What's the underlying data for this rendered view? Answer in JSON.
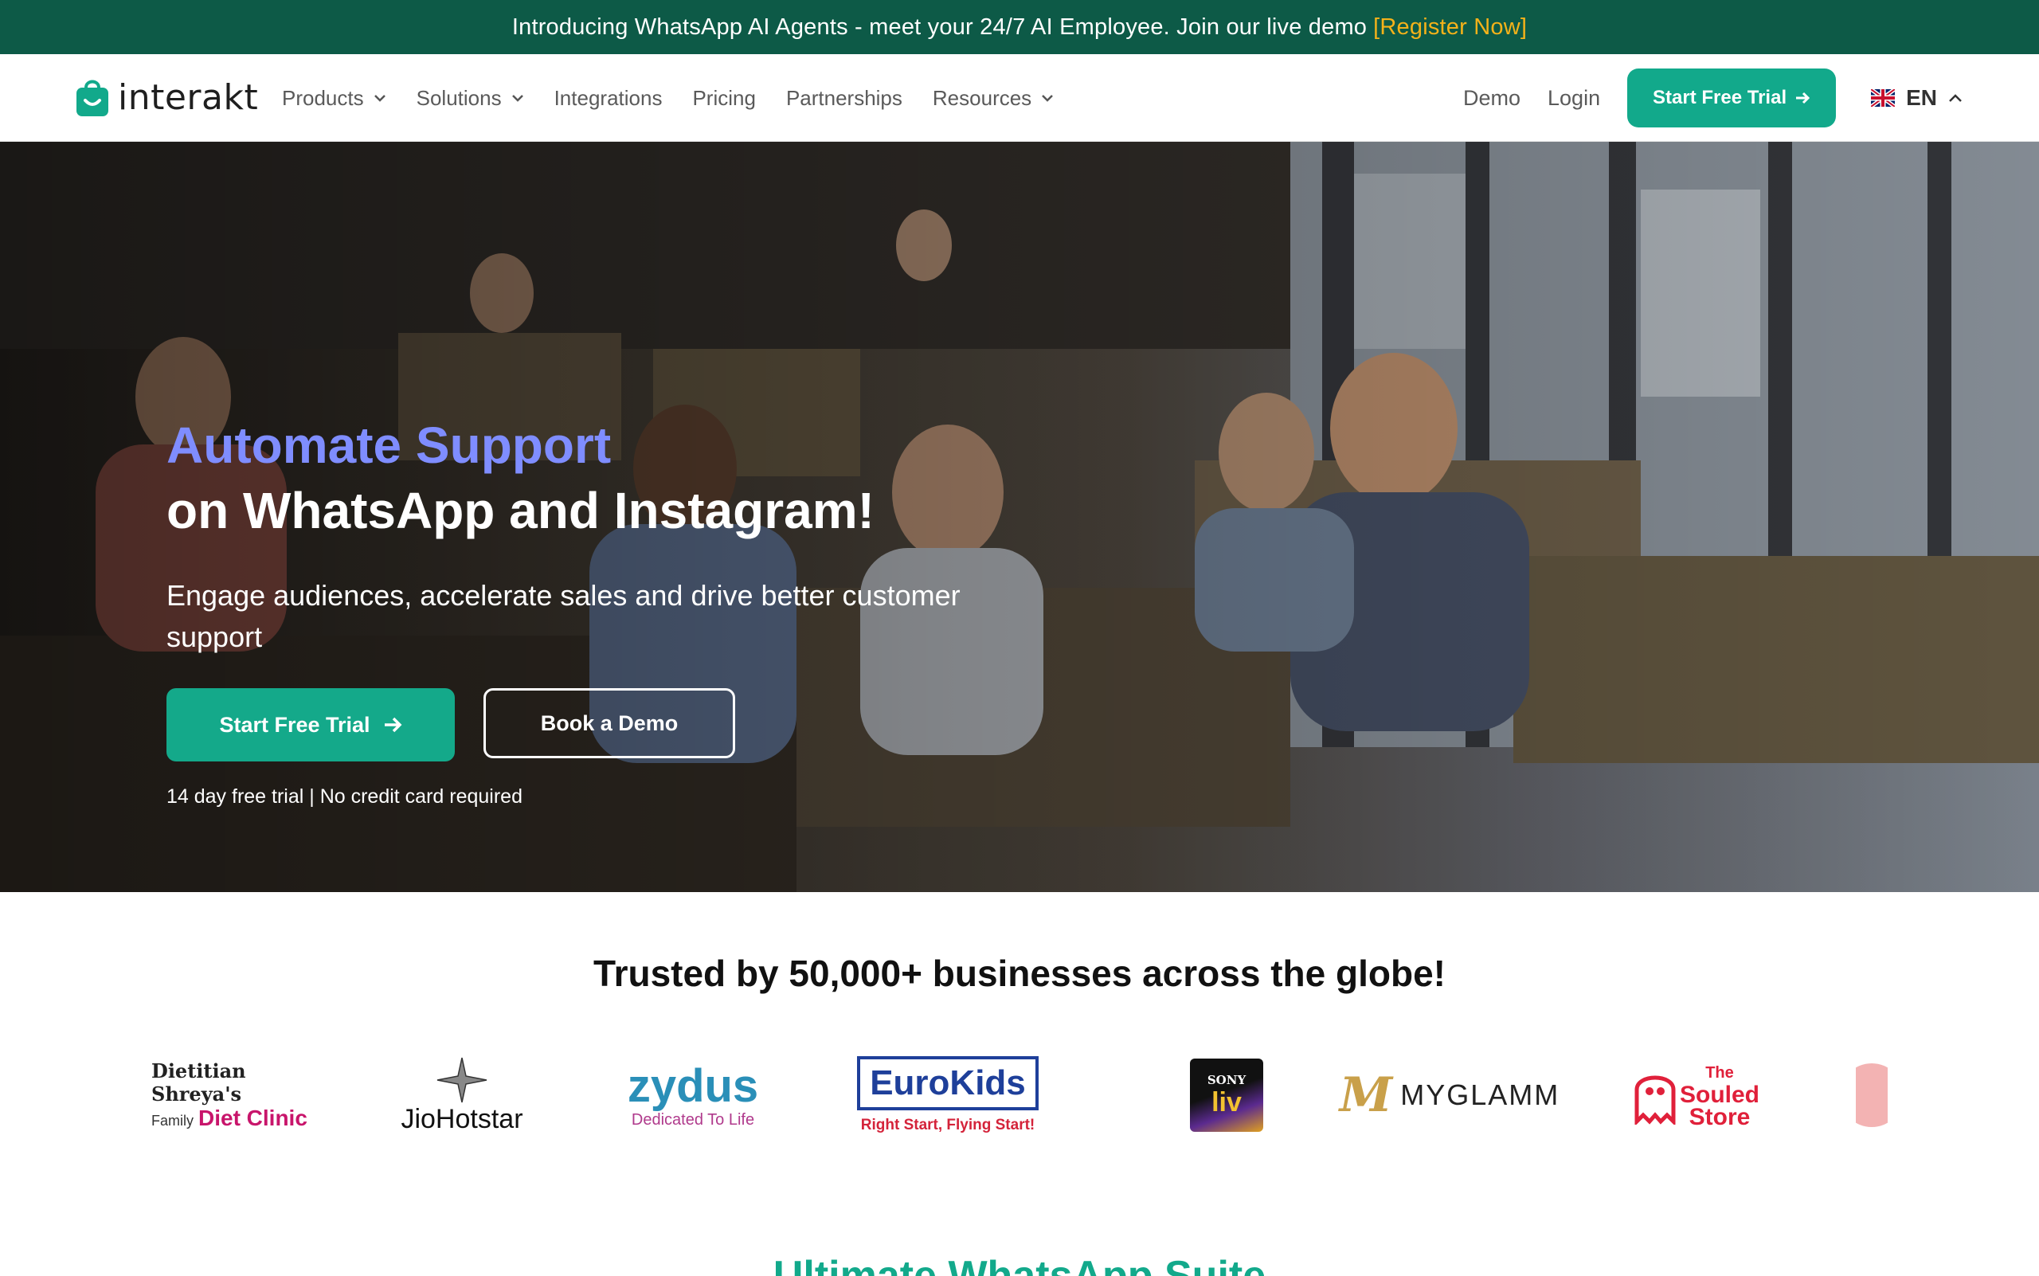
{
  "announcement": {
    "text": "Introducing WhatsApp AI Agents - meet your 24/7 AI Employee. Join our live demo",
    "link": "[Register Now]"
  },
  "brand": {
    "name": "interakt",
    "accent": "#12a98b",
    "dark_green": "#0d5a47",
    "highlight": "#7f8dff"
  },
  "nav": {
    "items": [
      {
        "label": "Products",
        "dropdown": true
      },
      {
        "label": "Solutions",
        "dropdown": true
      },
      {
        "label": "Integrations",
        "dropdown": false
      },
      {
        "label": "Pricing",
        "dropdown": false
      },
      {
        "label": "Partnerships",
        "dropdown": false
      },
      {
        "label": "Resources",
        "dropdown": true
      }
    ],
    "demo": "Demo",
    "login": "Login",
    "cta": "Start Free Trial",
    "language": "EN"
  },
  "hero": {
    "title_highlight": "Automate Support",
    "title_rest": "on WhatsApp and Instagram!",
    "subtitle": "Engage audiences, accelerate sales and drive better customer support",
    "primary_cta": "Start Free Trial",
    "secondary_cta": "Book a Demo",
    "note": "14 day free trial | No credit card required"
  },
  "trusted": {
    "heading": "Trusted by 50,000+ businesses across the globe!",
    "logos": [
      {
        "line1": "Dietitian Shreya's",
        "line2_a": "Family",
        "line2_b": "Diet Clinic"
      },
      {
        "name": "JioHotstar"
      },
      {
        "name": "zydus",
        "tagline": "Dedicated To Life"
      },
      {
        "name": "EuroKids",
        "tagline": "Right Start, Flying Start!"
      },
      {
        "brand": "SONY",
        "name": "liv"
      },
      {
        "name": "MYGLAMM"
      },
      {
        "line1": "The",
        "line2": "Souled",
        "line3": "Store"
      }
    ]
  },
  "next_section": {
    "heading": "Ultimate WhatsApp Suite"
  }
}
